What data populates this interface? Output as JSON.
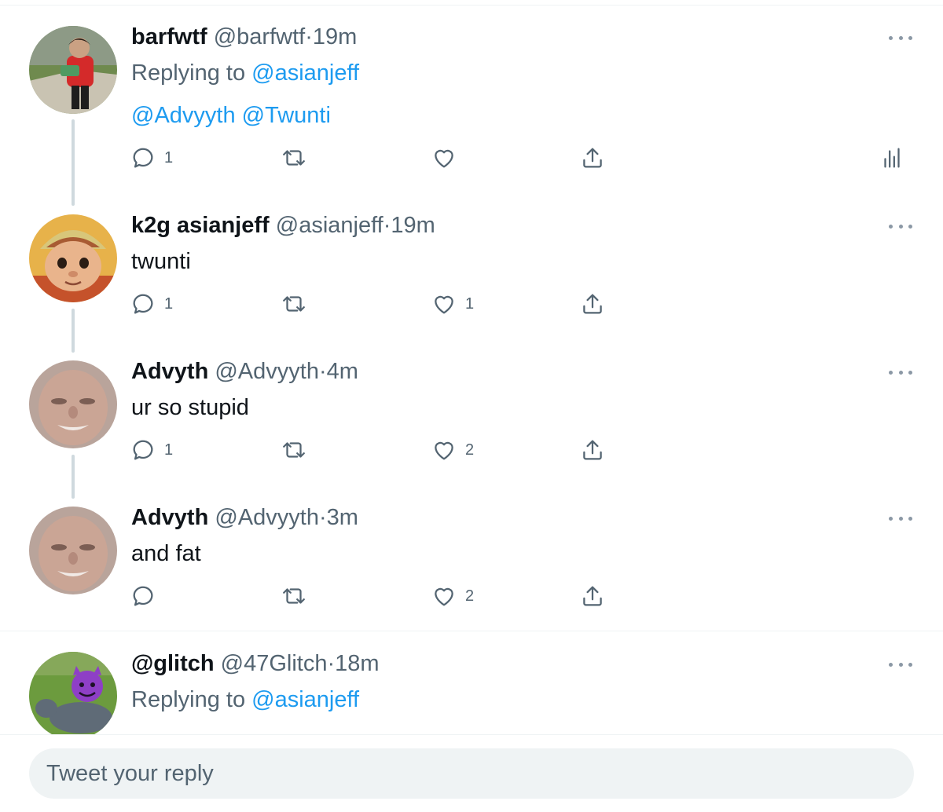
{
  "tweets": [
    {
      "name": "barfwtf",
      "handle": "@barfwtf",
      "sep": "·",
      "time": "19m",
      "replying_prefix": "Replying to",
      "replying_to": "@asianjeff",
      "mentions": [
        "@Advyyth",
        "@Twunti"
      ],
      "reply_count": "1",
      "retweet_count": "",
      "like_count": "",
      "has_analytics": true
    },
    {
      "name": "k2g asianjeff",
      "handle": "@asianjeff",
      "sep": "·",
      "time": "19m",
      "text": "twunti",
      "reply_count": "1",
      "retweet_count": "",
      "like_count": "1"
    },
    {
      "name": "Advyth",
      "handle": "@Advyyth",
      "sep": "·",
      "time": "4m",
      "text": "ur so stupid",
      "reply_count": "1",
      "retweet_count": "",
      "like_count": "2"
    },
    {
      "name": "Advyth",
      "handle": "@Advyyth",
      "sep": "·",
      "time": "3m",
      "text": "and fat",
      "reply_count": "",
      "retweet_count": "",
      "like_count": "2"
    },
    {
      "name": "@glitch",
      "handle": "@47Glitch",
      "sep": "·",
      "time": "18m",
      "replying_prefix": "Replying to",
      "replying_to": "@asianjeff"
    }
  ],
  "composer": {
    "placeholder": "Tweet your reply"
  },
  "colors": {
    "link": "#1d9bf0",
    "secondary_text": "#536471",
    "thread_line": "#cfd9de",
    "divider": "#eff3f4"
  },
  "icons": [
    "reply-icon",
    "retweet-icon",
    "like-icon",
    "share-icon",
    "analytics-icon",
    "more-icon"
  ]
}
